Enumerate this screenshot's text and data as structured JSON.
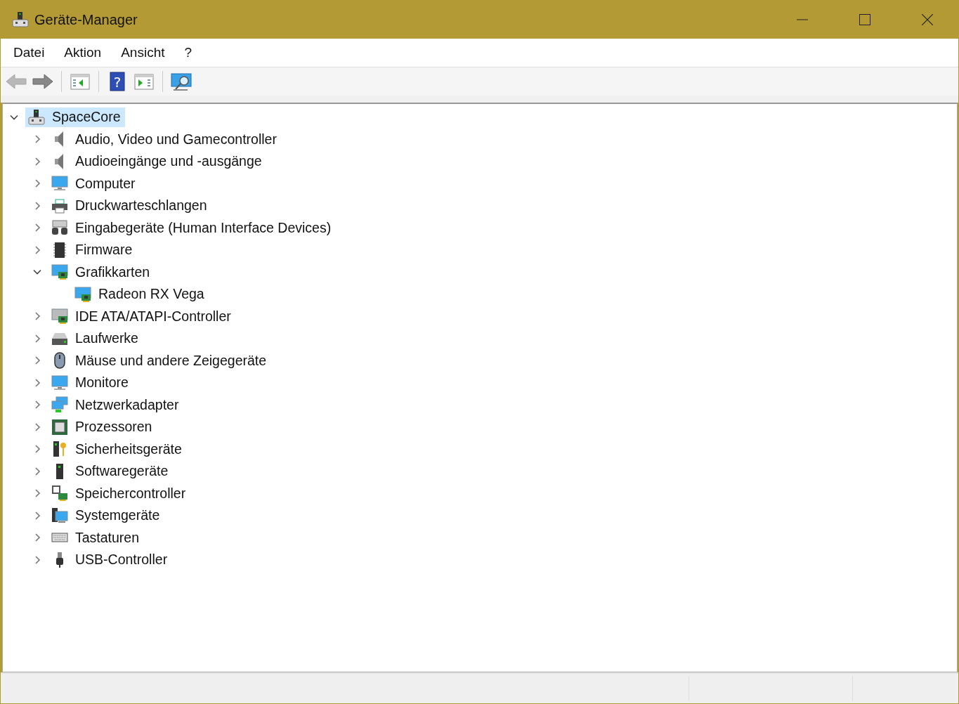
{
  "window": {
    "title": "Geräte-Manager"
  },
  "menu": [
    "Datei",
    "Aktion",
    "Ansicht",
    "?"
  ],
  "toolbar": [
    {
      "kind": "back",
      "disabled": true
    },
    {
      "kind": "forward",
      "disabled": false
    },
    {
      "kind": "separator"
    },
    {
      "kind": "pane-left",
      "disabled": false
    },
    {
      "kind": "separator"
    },
    {
      "kind": "help",
      "glyph": "?",
      "disabled": false
    },
    {
      "kind": "pane-right",
      "disabled": false
    },
    {
      "kind": "separator"
    },
    {
      "kind": "scan",
      "disabled": false
    }
  ],
  "tree": [
    {
      "label": "SpaceCore",
      "kind": "computer-node",
      "expanded": true,
      "selected": true,
      "children": [
        {
          "label": "Audio, Video und Gamecontroller",
          "kind": "speaker",
          "expanded": false,
          "selected": false
        },
        {
          "label": "Audioeingänge und -ausgänge",
          "kind": "speaker",
          "expanded": false,
          "selected": false
        },
        {
          "label": "Computer",
          "kind": "monitor",
          "expanded": false,
          "selected": false
        },
        {
          "label": "Druckwarteschlangen",
          "kind": "printer",
          "expanded": false,
          "selected": false
        },
        {
          "label": "Eingabegeräte (Human Interface Devices)",
          "kind": "hid",
          "expanded": false,
          "selected": false
        },
        {
          "label": "Firmware",
          "kind": "chip",
          "expanded": false,
          "selected": false
        },
        {
          "label": "Grafikkarten",
          "kind": "display-card",
          "expanded": true,
          "selected": false,
          "children": [
            {
              "label": "Radeon RX Vega",
              "kind": "display-card",
              "selected": false
            }
          ]
        },
        {
          "label": "IDE ATA/ATAPI-Controller",
          "kind": "controller",
          "expanded": false,
          "selected": false
        },
        {
          "label": "Laufwerke",
          "kind": "drive",
          "expanded": false,
          "selected": false
        },
        {
          "label": "Mäuse und andere Zeigegeräte",
          "kind": "mouse",
          "expanded": false,
          "selected": false
        },
        {
          "label": "Monitore",
          "kind": "monitor",
          "expanded": false,
          "selected": false
        },
        {
          "label": "Netzwerkadapter",
          "kind": "network",
          "expanded": false,
          "selected": false
        },
        {
          "label": "Prozessoren",
          "kind": "cpu",
          "expanded": false,
          "selected": false
        },
        {
          "label": "Sicherheitsgeräte",
          "kind": "security",
          "expanded": false,
          "selected": false
        },
        {
          "label": "Softwaregeräte",
          "kind": "tower",
          "expanded": false,
          "selected": false
        },
        {
          "label": "Speichercontroller",
          "kind": "storage",
          "expanded": false,
          "selected": false
        },
        {
          "label": "Systemgeräte",
          "kind": "system",
          "expanded": false,
          "selected": false
        },
        {
          "label": "Tastaturen",
          "kind": "keyboard",
          "expanded": false,
          "selected": false
        },
        {
          "label": "USB-Controller",
          "kind": "usb",
          "expanded": false,
          "selected": false
        }
      ]
    }
  ]
}
